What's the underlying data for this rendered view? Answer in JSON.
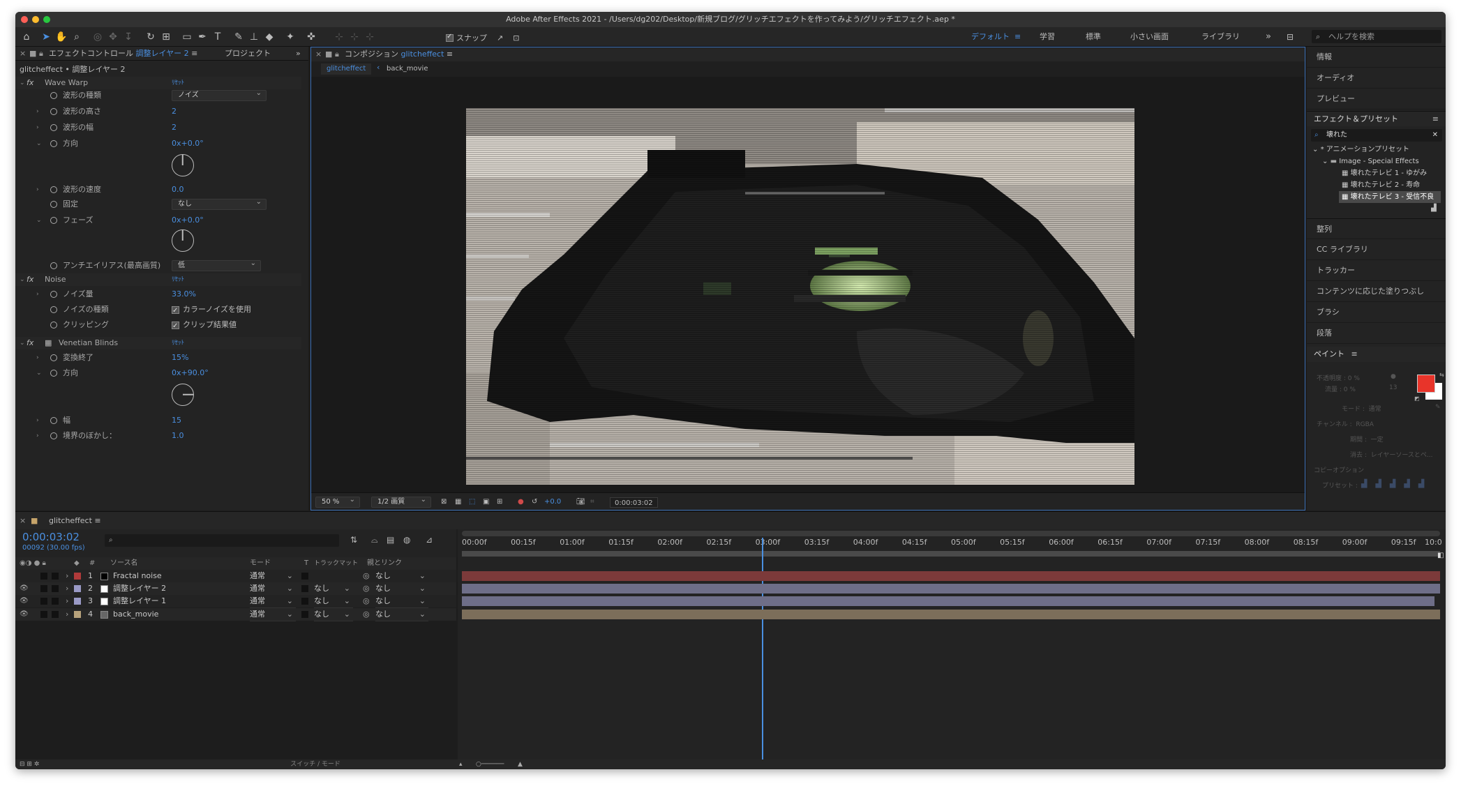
{
  "window": {
    "title": "Adobe After Effects 2021 - /Users/dg202/Desktop/新規ブログ/グリッチエフェクトを作ってみよう/グリッチエフェクト.aep *"
  },
  "toolbar": {
    "snap_label": "スナップ",
    "workspaces": [
      "デフォルト",
      "学習",
      "標準",
      "小さい画面",
      "ライブラリ"
    ],
    "search_placeholder": "ヘルプを検索"
  },
  "effects_panel": {
    "tab_label": "エフェクトコントロール",
    "tab_layer": "調整レイヤー 2",
    "tab_project": "プロジェクト",
    "subtitle": "glitcheffect • 調整レイヤー 2",
    "reset": "ﾘｾｯﾄ",
    "wave_warp": {
      "name": "Wave Warp",
      "wave_type_label": "波形の種類",
      "wave_type_value": "ノイズ",
      "wave_height_label": "波形の高さ",
      "wave_height_value": "2",
      "wave_width_label": "波形の幅",
      "wave_width_value": "2",
      "direction_label": "方向",
      "direction_value": "0x+0.0°",
      "wave_speed_label": "波形の速度",
      "wave_speed_value": "0.0",
      "pinning_label": "固定",
      "pinning_value": "なし",
      "phase_label": "フェーズ",
      "phase_value": "0x+0.0°",
      "antialias_label": "アンチエイリアス(最高画質)",
      "antialias_value": "低"
    },
    "noise": {
      "name": "Noise",
      "amount_label": "ノイズ量",
      "amount_value": "33.0%",
      "type_label": "ノイズの種類",
      "type_value": "カラーノイズを使用",
      "clip_label": "クリッピング",
      "clip_value": "クリップ結果値"
    },
    "venetian": {
      "name": "Venetian Blinds",
      "transition_label": "変換終了",
      "transition_value": "15%",
      "direction_label": "方向",
      "direction_value": "0x+90.0°",
      "width_label": "幅",
      "width_value": "15",
      "feather_label": "境界のぼかし：",
      "feather_value": "1.0"
    }
  },
  "composition": {
    "tab_label": "コンポジション",
    "tab_comp": "glitcheffect",
    "crumb_active": "glitcheffect",
    "crumb_other": "back_movie",
    "zoom": "50 %",
    "quality": "1/2 画質",
    "exposure": "+0.0",
    "timecode": "0:00:03:02"
  },
  "right_panels": {
    "info": "情報",
    "audio": "オーディオ",
    "preview": "プレビュー",
    "effects_presets": "エフェクト＆プリセット",
    "search_value": "壊れた",
    "tree_root": "* アニメーションプリセット",
    "tree_folder": "Image - Special Effects",
    "presets": [
      "壊れたテレビ 1 - ゆがみ",
      "壊れたテレビ 2 - 寿命",
      "壊れたテレビ 3 - 受信不良"
    ],
    "align": "整列",
    "cc_library": "CC ライブラリ",
    "tracker": "トラッカー",
    "content_fill": "コンテンツに応じた塗りつぶし",
    "brush": "ブラシ",
    "paragraph": "段落",
    "paint": {
      "title": "ペイント",
      "opacity": "不透明度 : 0 %",
      "flow": "流量 : 0 %",
      "mode_label": "モード :",
      "mode_value": "通常",
      "channel_label": "チャンネル :",
      "channel_value": "RGBA",
      "duration_label": "期間 :",
      "duration_value": "一定",
      "erase_label": "消去 :",
      "erase_value": "レイヤーソースとペ...",
      "clone_options": "コピーオプション",
      "preset_label": "プリセット :",
      "brush_size": "13",
      "fg_color": "#e8342a"
    }
  },
  "timeline": {
    "comp_name": "glitcheffect",
    "timecode": "0:00:03:02",
    "frames": "00092 (30.00 fps)",
    "columns": {
      "source": "ソース名",
      "mode": "モード",
      "t": "T",
      "track": "トラックマット",
      "parent": "親とリンク",
      "num": "#"
    },
    "layers": [
      {
        "num": "1",
        "name": "Fractal noise",
        "mode": "通常",
        "track": "",
        "parent": "なし",
        "color": "#b03a3a",
        "bar": "#7c3a3a"
      },
      {
        "num": "2",
        "name": "調整レイヤー 2",
        "mode": "通常",
        "track": "なし",
        "parent": "なし",
        "color": "#9a9ac6",
        "bar": "#6e6e88"
      },
      {
        "num": "3",
        "name": "調整レイヤー 1",
        "mode": "通常",
        "track": "なし",
        "parent": "なし",
        "color": "#9a9ac6",
        "bar": "#6e6e88"
      },
      {
        "num": "4",
        "name": "back_movie",
        "mode": "通常",
        "track": "なし",
        "parent": "なし",
        "color": "#b8a37c",
        "bar": "#7c6e5a"
      }
    ],
    "ruler": [
      "00:00f",
      "00:15f",
      "01:00f",
      "01:15f",
      "02:00f",
      "02:15f",
      "03:00f",
      "03:15f",
      "04:00f",
      "04:15f",
      "05:00f",
      "05:15f",
      "06:00f",
      "06:15f",
      "07:00f",
      "07:15f",
      "08:00f",
      "08:15f",
      "09:00f",
      "09:15f",
      "10:0"
    ],
    "playhead_seconds": 3.067,
    "duration_seconds": 10,
    "switch_mode": "スイッチ / モード"
  }
}
